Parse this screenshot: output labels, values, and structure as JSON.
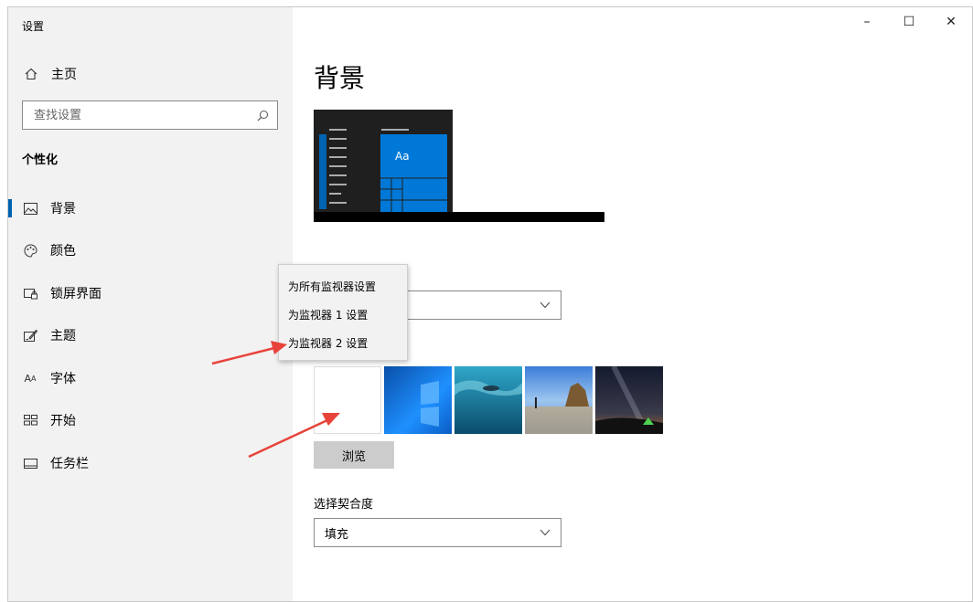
{
  "window": {
    "title": "设置",
    "controls": {
      "minimize": "–",
      "maximize": "☐",
      "close": "✕"
    }
  },
  "sidebar": {
    "home_label": "主页",
    "search_placeholder": "查找设置",
    "section_title": "个性化",
    "items": [
      {
        "label": "背景",
        "icon": "picture-icon",
        "active": true
      },
      {
        "label": "颜色",
        "icon": "palette-icon",
        "active": false
      },
      {
        "label": "锁屏界面",
        "icon": "lock-screen-icon",
        "active": false
      },
      {
        "label": "主题",
        "icon": "theme-icon",
        "active": false
      },
      {
        "label": "字体",
        "icon": "font-icon",
        "active": false
      },
      {
        "label": "开始",
        "icon": "start-icon",
        "active": false
      },
      {
        "label": "任务栏",
        "icon": "taskbar-icon",
        "active": false
      }
    ]
  },
  "main": {
    "title": "背景",
    "preview": {
      "tile_text": "Aa"
    },
    "background_dropdown_value": "",
    "context_menu": {
      "items": [
        "为所有监视器设置",
        "为监视器 1 设置",
        "为监视器 2 设置"
      ]
    },
    "browse_label": "浏览",
    "fit_label": "选择契合度",
    "fit_value": "填充"
  },
  "colors": {
    "accent": "#0063b1",
    "sidebar_bg": "#f2f2f2",
    "annotation_arrow": "#e8433a"
  }
}
